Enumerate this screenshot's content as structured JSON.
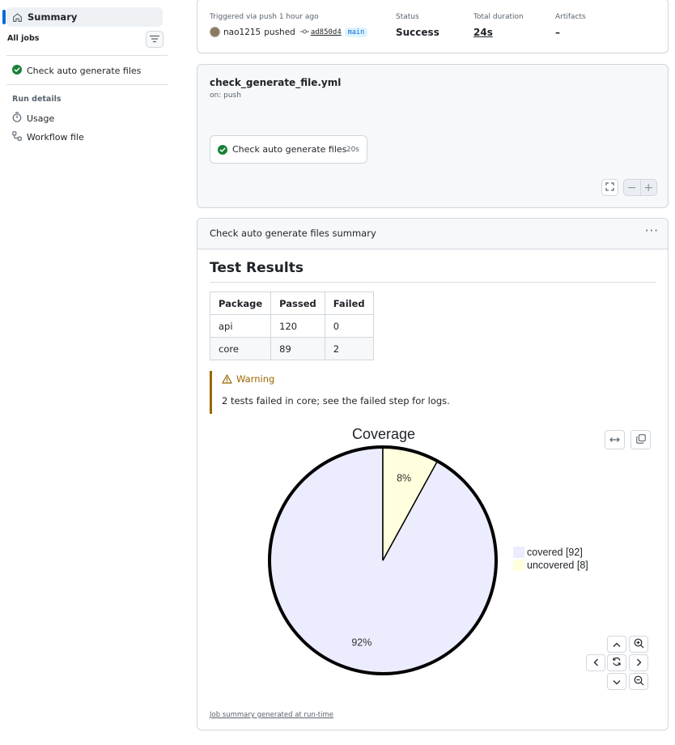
{
  "sidebar": {
    "summary_label": "Summary",
    "all_jobs_label": "All jobs",
    "jobs": [
      {
        "label": "Check auto generate files",
        "status": "success"
      }
    ],
    "run_details_label": "Run details",
    "links": [
      {
        "label": "Usage",
        "icon": "stopwatch-icon"
      },
      {
        "label": "Workflow file",
        "icon": "workflow-icon"
      }
    ]
  },
  "run_info": {
    "trigger_label": "Triggered via push 1 hour ago",
    "actor": "nao1215",
    "action": "pushed",
    "commit": "ad850d4",
    "branch": "main",
    "status_label": "Status",
    "status_value": "Success",
    "duration_label": "Total duration",
    "duration_value": "24s",
    "artifacts_label": "Artifacts",
    "artifacts_value": "–"
  },
  "workflow": {
    "file_name": "check_generate_file.yml",
    "trigger": "on: push",
    "job_label": "Check auto generate files",
    "job_duration": "20s",
    "zoom_out": "−",
    "zoom_in": "+"
  },
  "summary": {
    "header": "Check auto generate files summary",
    "heading": "Test Results",
    "table": {
      "columns": [
        "Package",
        "Passed",
        "Failed"
      ],
      "rows": [
        [
          "api",
          "120",
          "0"
        ],
        [
          "core",
          "89",
          "2"
        ]
      ]
    },
    "warning_title": "Warning",
    "warning_text": "2 tests failed in core; see the failed step for logs.",
    "footer": "Job summary generated at run-time"
  },
  "chart_data": {
    "type": "pie",
    "title": "Coverage",
    "slices": [
      {
        "label": "covered",
        "value": 92,
        "percent_label": "92%",
        "legend": "covered [92]",
        "color": "#ececff"
      },
      {
        "label": "uncovered",
        "value": 8,
        "percent_label": "8%",
        "legend": "uncovered [8]",
        "color": "#ffffde"
      }
    ],
    "legend_position": "right"
  },
  "colors": {
    "accent": "#0969da",
    "success": "#1a7f37",
    "warning": "#9a6700"
  }
}
